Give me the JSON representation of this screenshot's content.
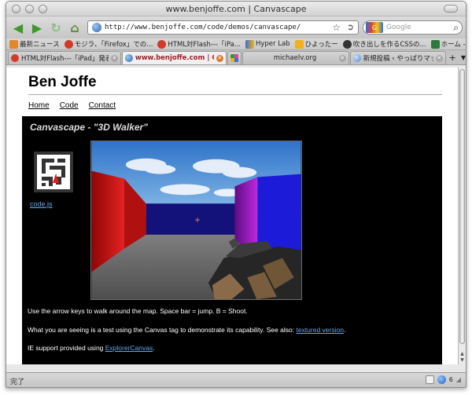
{
  "window": {
    "title": "www.benjoffe.com | Canvascape"
  },
  "toolbar": {
    "url": "http://www.benjoffe.com/code/demos/canvascape/",
    "search_placeholder": "Google",
    "search_engine": "G"
  },
  "bookmarks": [
    {
      "label": "最新ニュース",
      "color": "#e0882a"
    },
    {
      "label": "モジラ、「Firefox」での...",
      "color": "#d23a2a"
    },
    {
      "label": "HTML対Flash---「iPa...",
      "color": "#d23a2a"
    },
    {
      "label": "Hyper Lab",
      "color": "#3a6fd0"
    },
    {
      "label": "ひよったー",
      "color": "#f2b01e"
    },
    {
      "label": "吹き出しを作るCSSの...",
      "color": "#333333"
    },
    {
      "label": "ホーム - The Django...",
      "color": "#2c7a3a"
    }
  ],
  "bookmarks_more": "»",
  "tabs": [
    {
      "label": "HTML対Flash---「iPad」発表...",
      "active": false,
      "color": "#d23a2a"
    },
    {
      "label": "www.benjoffe.com | Can...",
      "active": true,
      "color": "#4a86d8"
    },
    {
      "label": "",
      "active": false,
      "color": "#e040a0"
    },
    {
      "label": "michaelv.org",
      "active": false,
      "color": "#888888"
    },
    {
      "label": "新規投稿 ‹ やっぱりマックでし...",
      "active": false,
      "color": "#4a86d8"
    }
  ],
  "page": {
    "site_title": "Ben Joffe",
    "menu": [
      "Home",
      "Code",
      "Contact"
    ],
    "demo_title": "Canvascape - \"3D Walker\"",
    "code_link": "code.js",
    "line1": "Use the arrow keys to walk around the map. Space bar = jump. B = Shoot.",
    "line2_prefix": "What you are seeing is a test using the Canvas tag to demonstrate its capability. See also: ",
    "line2_link": "textured version",
    "line2_suffix": ".",
    "line3_prefix": "IE support provided using ",
    "line3_link": "ExplorerCanvas",
    "line3_suffix": "."
  },
  "status": {
    "text": "完了",
    "count": "6"
  }
}
